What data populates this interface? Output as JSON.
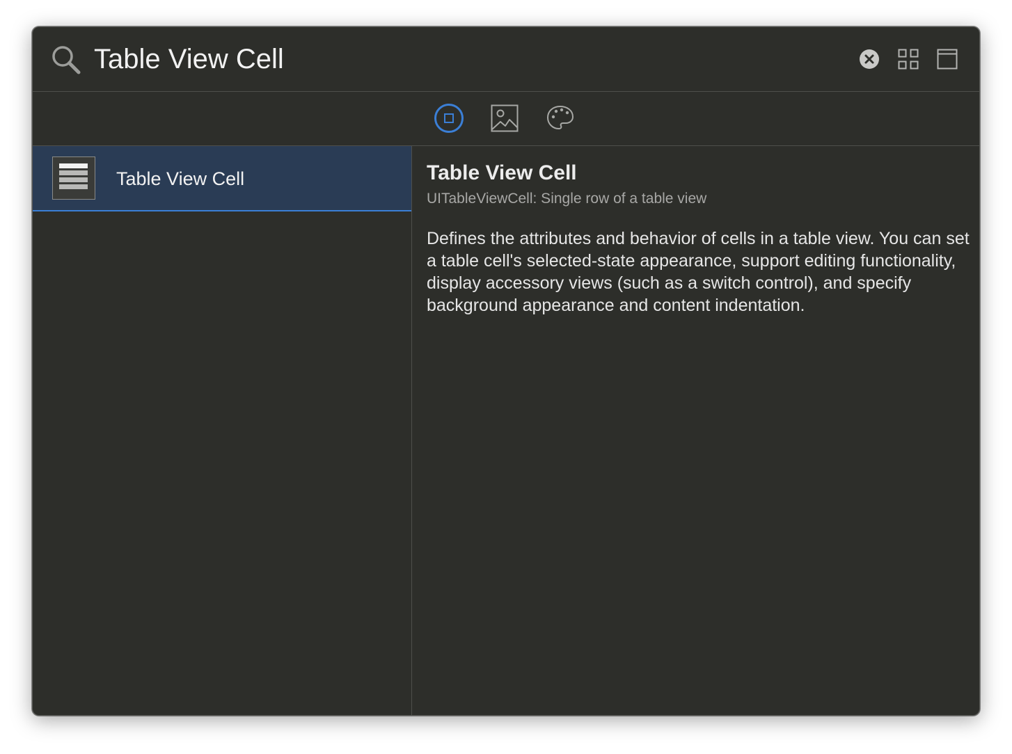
{
  "search": {
    "value": "Table View Cell",
    "placeholder": ""
  },
  "header": {
    "icons": [
      "search-icon",
      "clear-icon",
      "grid-view-icon",
      "detail-view-icon"
    ]
  },
  "filters": {
    "tabs": [
      {
        "name": "objects",
        "icon": "object-square-icon",
        "selected": true
      },
      {
        "name": "media",
        "icon": "image-icon",
        "selected": false
      },
      {
        "name": "colors",
        "icon": "palette-icon",
        "selected": false
      }
    ]
  },
  "list": {
    "items": [
      {
        "label": "Table View Cell",
        "icon": "table-view-cell-icon",
        "selected": true
      }
    ]
  },
  "detail": {
    "title": "Table View Cell",
    "subtitle": "UITableViewCell: Single row of a table view",
    "description": "Defines the attributes and behavior of cells in a table view. You can set a table cell's selected-state appearance, support editing functionality, display accessory views (such as a switch control), and specify background appearance and content indentation."
  },
  "colors": {
    "background": "#2d2e2a",
    "accent": "#3b7fd6",
    "selection": "#2a3c55"
  }
}
